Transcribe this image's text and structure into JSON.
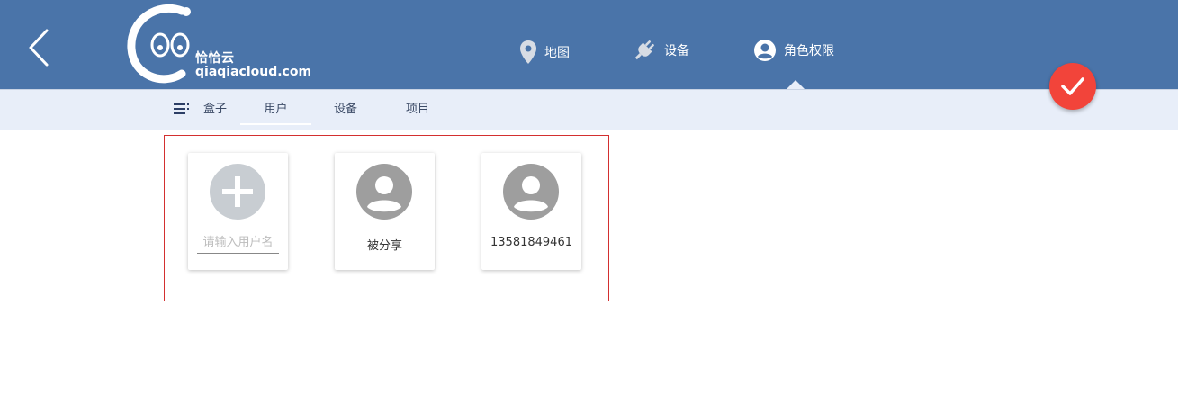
{
  "header": {
    "logo": {
      "cn": "恰恰云",
      "en": "qiaqiacloud.com"
    },
    "nav": [
      {
        "label": "地图",
        "icon": "map-marker-icon"
      },
      {
        "label": "设备",
        "icon": "plug-icon"
      },
      {
        "label": "角色权限",
        "icon": "user-circle-icon"
      }
    ],
    "active_nav": "角色权限"
  },
  "subnav": {
    "tabs": [
      {
        "label": "盒子"
      },
      {
        "label": "用户"
      },
      {
        "label": "设备"
      },
      {
        "label": "项目"
      }
    ],
    "active_tab": "用户"
  },
  "cards": {
    "add": {
      "placeholder": "请输入用户名",
      "value": ""
    },
    "users": [
      {
        "label": "被分享"
      },
      {
        "label": "13581849461"
      }
    ]
  },
  "colors": {
    "header_bg": "#4a74a9",
    "subbar_bg": "#e8eef9",
    "fab_bg": "#f2443a",
    "frame_border": "#d32f2f"
  }
}
